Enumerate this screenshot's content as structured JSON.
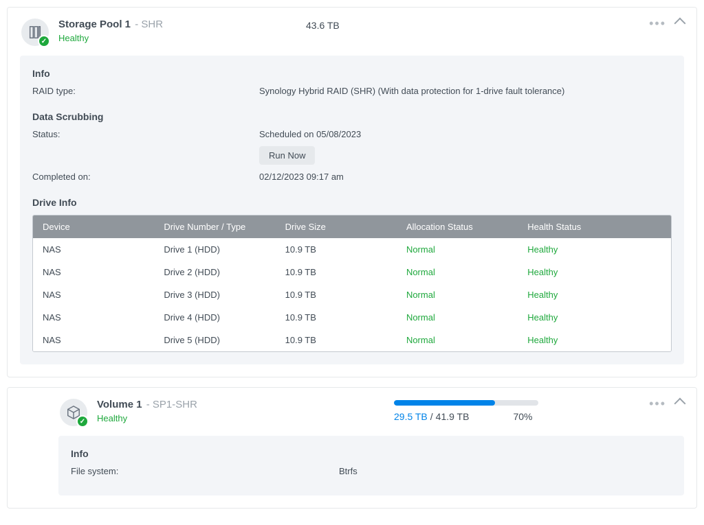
{
  "pool": {
    "title": "Storage Pool 1",
    "subtitle": "- SHR",
    "status": "Healthy",
    "capacity": "43.6 TB",
    "info": {
      "heading": "Info",
      "raid_type_label": "RAID type:",
      "raid_type_value": "Synology Hybrid RAID (SHR) (With data protection for 1-drive fault tolerance)"
    },
    "scrubbing": {
      "heading": "Data Scrubbing",
      "status_label": "Status:",
      "status_value": "Scheduled on 05/08/2023",
      "run_now_label": "Run Now",
      "completed_label": "Completed on:",
      "completed_value": "02/12/2023 09:17 am"
    },
    "drive_info": {
      "heading": "Drive Info",
      "columns": {
        "device": "Device",
        "number": "Drive Number / Type",
        "size": "Drive Size",
        "alloc": "Allocation Status",
        "health": "Health Status"
      },
      "rows": [
        {
          "device": "NAS",
          "number": "Drive 1 (HDD)",
          "size": "10.9 TB",
          "alloc": "Normal",
          "health": "Healthy"
        },
        {
          "device": "NAS",
          "number": "Drive 2 (HDD)",
          "size": "10.9 TB",
          "alloc": "Normal",
          "health": "Healthy"
        },
        {
          "device": "NAS",
          "number": "Drive 3 (HDD)",
          "size": "10.9 TB",
          "alloc": "Normal",
          "health": "Healthy"
        },
        {
          "device": "NAS",
          "number": "Drive 4 (HDD)",
          "size": "10.9 TB",
          "alloc": "Normal",
          "health": "Healthy"
        },
        {
          "device": "NAS",
          "number": "Drive 5 (HDD)",
          "size": "10.9 TB",
          "alloc": "Normal",
          "health": "Healthy"
        }
      ]
    }
  },
  "volume": {
    "title": "Volume 1",
    "subtitle": "- SP1-SHR",
    "status": "Healthy",
    "used": "29.5 TB",
    "sep": " / ",
    "total": "41.9 TB",
    "percent": "70%",
    "percent_num": 70,
    "info": {
      "heading": "Info",
      "fs_label": "File system:",
      "fs_value": "Btrfs"
    }
  }
}
